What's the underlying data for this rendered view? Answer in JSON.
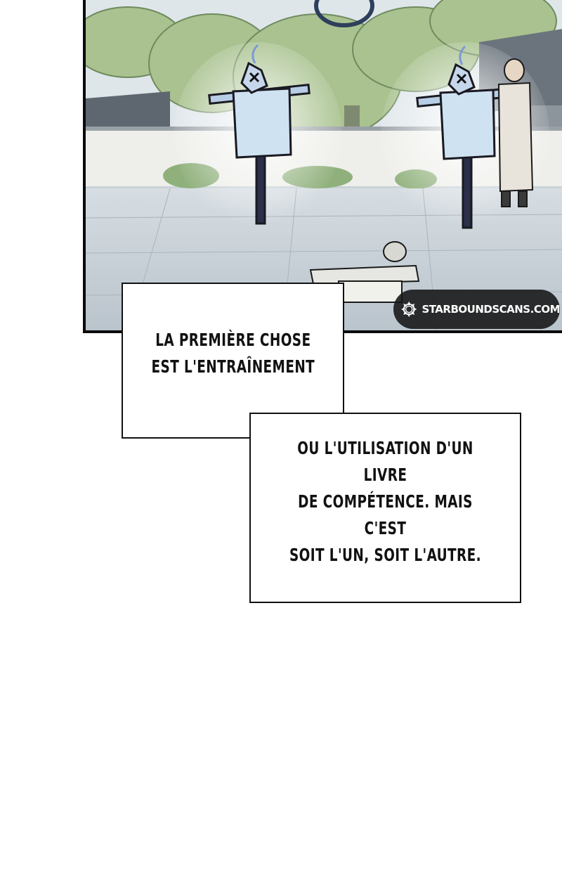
{
  "panel": {
    "scene": "courtyard-training-scene",
    "colors": {
      "sky": "#dfe6ea",
      "wall": "#eeeeea",
      "tree": "#a9c28f",
      "ground": "#c4ccd3",
      "scarecrow": "#cfe2f2"
    }
  },
  "watermark": {
    "text": "STARBOUNDSCANS.COM",
    "icon": "gear-icon"
  },
  "bubbles": {
    "first": "La première chose\nest l'entraînement",
    "second": "ou l'utilisation d'un livre\nde compétence. Mais c'est\nsoit l'un, soit l'autre."
  }
}
